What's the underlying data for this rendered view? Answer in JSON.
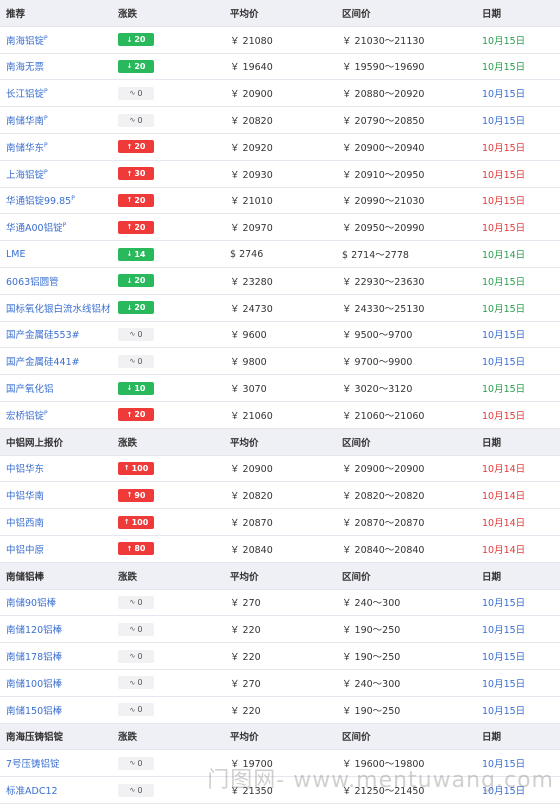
{
  "sections": [
    {
      "header": {
        "name": "推荐",
        "change": "涨跌",
        "avg": "平均价",
        "range": "区间价",
        "date": "日期"
      },
      "rows": [
        {
          "name": "南海铝锭",
          "mark": "P",
          "trend": "down",
          "change": "20",
          "avg": "￥ 21080",
          "range": "￥ 21030～21130",
          "date": "10月15日",
          "dateColor": "green"
        },
        {
          "name": "南海无票",
          "mark": "",
          "trend": "down",
          "change": "20",
          "avg": "￥ 19640",
          "range": "￥ 19590～19690",
          "date": "10月15日",
          "dateColor": "green"
        },
        {
          "name": "长江铝锭",
          "mark": "P",
          "trend": "flat",
          "change": "0",
          "avg": "￥ 20900",
          "range": "￥ 20880～20920",
          "date": "10月15日",
          "dateColor": "blue"
        },
        {
          "name": "南储华南",
          "mark": "P",
          "trend": "flat",
          "change": "0",
          "avg": "￥ 20820",
          "range": "￥ 20790～20850",
          "date": "10月15日",
          "dateColor": "blue"
        },
        {
          "name": "南储华东",
          "mark": "P",
          "trend": "up",
          "change": "20",
          "avg": "￥ 20920",
          "range": "￥ 20900～20940",
          "date": "10月15日",
          "dateColor": "red"
        },
        {
          "name": "上海铝锭",
          "mark": "P",
          "trend": "up",
          "change": "30",
          "avg": "￥ 20930",
          "range": "￥ 20910～20950",
          "date": "10月15日",
          "dateColor": "red"
        },
        {
          "name": "华通铝锭99.85",
          "mark": "P",
          "trend": "up",
          "change": "20",
          "avg": "￥ 21010",
          "range": "￥ 20990～21030",
          "date": "10月15日",
          "dateColor": "red"
        },
        {
          "name": "华通A00铝锭",
          "mark": "P",
          "trend": "up",
          "change": "20",
          "avg": "￥ 20970",
          "range": "￥ 20950～20990",
          "date": "10月15日",
          "dateColor": "red"
        },
        {
          "name": "LME",
          "mark": "",
          "trend": "down",
          "change": "14",
          "avg": "$ 2746",
          "range": "$ 2714～2778",
          "date": "10月14日",
          "dateColor": "green"
        },
        {
          "name": "6063铝圆管",
          "mark": "",
          "trend": "down",
          "change": "20",
          "avg": "￥ 23280",
          "range": "￥ 22930～23630",
          "date": "10月15日",
          "dateColor": "green"
        },
        {
          "name": "国标氧化银白流水线铝材",
          "mark": "",
          "trend": "down",
          "change": "20",
          "avg": "￥ 24730",
          "range": "￥ 24330～25130",
          "date": "10月15日",
          "dateColor": "green"
        },
        {
          "name": "国产金属硅553#",
          "mark": "",
          "trend": "flat",
          "change": "0",
          "avg": "￥ 9600",
          "range": "￥ 9500～9700",
          "date": "10月15日",
          "dateColor": "blue"
        },
        {
          "name": "国产金属硅441#",
          "mark": "",
          "trend": "flat",
          "change": "0",
          "avg": "￥ 9800",
          "range": "￥ 9700～9900",
          "date": "10月15日",
          "dateColor": "blue"
        },
        {
          "name": "国产氧化铝",
          "mark": "",
          "trend": "down",
          "change": "10",
          "avg": "￥ 3070",
          "range": "￥ 3020～3120",
          "date": "10月15日",
          "dateColor": "green"
        },
        {
          "name": "宏桥铝锭",
          "mark": "P",
          "trend": "up",
          "change": "20",
          "avg": "￥ 21060",
          "range": "￥ 21060～21060",
          "date": "10月15日",
          "dateColor": "red"
        }
      ]
    },
    {
      "header": {
        "name": "中铝网上报价",
        "change": "涨跌",
        "avg": "平均价",
        "range": "区间价",
        "date": "日期"
      },
      "rows": [
        {
          "name": "中铝华东",
          "mark": "",
          "trend": "up",
          "change": "100",
          "avg": "￥ 20900",
          "range": "￥ 20900～20900",
          "date": "10月14日",
          "dateColor": "red"
        },
        {
          "name": "中铝华南",
          "mark": "",
          "trend": "up",
          "change": "90",
          "avg": "￥ 20820",
          "range": "￥ 20820～20820",
          "date": "10月14日",
          "dateColor": "red"
        },
        {
          "name": "中铝西南",
          "mark": "",
          "trend": "up",
          "change": "100",
          "avg": "￥ 20870",
          "range": "￥ 20870～20870",
          "date": "10月14日",
          "dateColor": "red"
        },
        {
          "name": "中铝中原",
          "mark": "",
          "trend": "up",
          "change": "80",
          "avg": "￥ 20840",
          "range": "￥ 20840～20840",
          "date": "10月14日",
          "dateColor": "red"
        }
      ]
    },
    {
      "header": {
        "name": "南储铝棒",
        "change": "涨跌",
        "avg": "平均价",
        "range": "区间价",
        "date": "日期"
      },
      "rows": [
        {
          "name": "南储90铝棒",
          "mark": "",
          "trend": "flat",
          "change": "0",
          "avg": "￥ 270",
          "range": "￥ 240～300",
          "date": "10月15日",
          "dateColor": "blue"
        },
        {
          "name": "南储120铝棒",
          "mark": "",
          "trend": "flat",
          "change": "0",
          "avg": "￥ 220",
          "range": "￥ 190～250",
          "date": "10月15日",
          "dateColor": "blue"
        },
        {
          "name": "南储178铝棒",
          "mark": "",
          "trend": "flat",
          "change": "0",
          "avg": "￥ 220",
          "range": "￥ 190～250",
          "date": "10月15日",
          "dateColor": "blue"
        },
        {
          "name": "南储100铝棒",
          "mark": "",
          "trend": "flat",
          "change": "0",
          "avg": "￥ 270",
          "range": "￥ 240～300",
          "date": "10月15日",
          "dateColor": "blue"
        },
        {
          "name": "南储150铝棒",
          "mark": "",
          "trend": "flat",
          "change": "0",
          "avg": "￥ 220",
          "range": "￥ 190～250",
          "date": "10月15日",
          "dateColor": "blue"
        }
      ]
    },
    {
      "header": {
        "name": "南海压铸铝锭",
        "change": "涨跌",
        "avg": "平均价",
        "range": "区间价",
        "date": "日期"
      },
      "rows": [
        {
          "name": "7号压铸铝锭",
          "mark": "",
          "trend": "flat",
          "change": "0",
          "avg": "￥ 19700",
          "range": "￥ 19600～19800",
          "date": "10月15日",
          "dateColor": "blue"
        },
        {
          "name": "标准ADC12",
          "mark": "",
          "trend": "flat",
          "change": "0",
          "avg": "￥ 21350",
          "range": "￥ 21250～21450",
          "date": "10月15日",
          "dateColor": "blue"
        }
      ]
    }
  ],
  "watermark": "门图网- www.mentuwang.com",
  "icons": {
    "down": "arrow-down-icon",
    "up": "arrow-up-icon",
    "flat": "wave-icon"
  },
  "colors": {
    "green": "#2ab85c",
    "red": "#ef3a3a",
    "blue": "#3a6fd0",
    "header_bg": "#efeff6"
  }
}
